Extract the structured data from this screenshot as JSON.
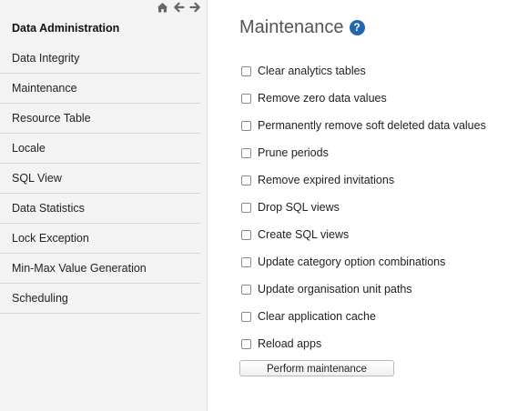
{
  "sidebar": {
    "title": "Data Administration",
    "items": [
      {
        "label": "Data Integrity"
      },
      {
        "label": "Maintenance"
      },
      {
        "label": "Resource Table"
      },
      {
        "label": "Locale"
      },
      {
        "label": "SQL View"
      },
      {
        "label": "Data Statistics"
      },
      {
        "label": "Lock Exception"
      },
      {
        "label": "Min-Max Value Generation"
      },
      {
        "label": "Scheduling"
      }
    ]
  },
  "topnav": {
    "icons": [
      "home-icon",
      "arrow-left-icon",
      "arrow-right-icon"
    ]
  },
  "main": {
    "title": "Maintenance",
    "help_icon_text": "?",
    "help_color": "#1f68b1",
    "options": [
      {
        "label": "Clear analytics tables",
        "checked": false
      },
      {
        "label": "Remove zero data values",
        "checked": false
      },
      {
        "label": "Permanently remove soft deleted data values",
        "checked": false
      },
      {
        "label": "Prune periods",
        "checked": false
      },
      {
        "label": "Remove expired invitations",
        "checked": false
      },
      {
        "label": "Drop SQL views",
        "checked": false
      },
      {
        "label": "Create SQL views",
        "checked": false
      },
      {
        "label": "Update category option combinations",
        "checked": false
      },
      {
        "label": "Update organisation unit paths",
        "checked": false
      },
      {
        "label": "Clear application cache",
        "checked": false
      },
      {
        "label": "Reload apps",
        "checked": false
      }
    ],
    "button_label": "Perform maintenance"
  }
}
